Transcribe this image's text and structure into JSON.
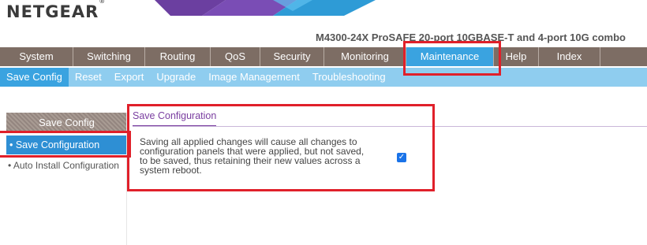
{
  "brand": {
    "logo": "NETGEAR",
    "trademark": "®"
  },
  "model": "M4300-24X ProSAFE 20-port 10GBASE-T and 4-port 10G combo",
  "nav": {
    "items": [
      "System",
      "Switching",
      "Routing",
      "QoS",
      "Security",
      "Monitoring",
      "Maintenance",
      "Help",
      "Index"
    ],
    "active": "Maintenance"
  },
  "subnav": {
    "items": [
      "Save Config",
      "Reset",
      "Export",
      "Upgrade",
      "Image Management",
      "Troubleshooting"
    ],
    "active": "Save Config"
  },
  "sidebar": {
    "header": "Save Config",
    "selected": "• Save Configuration",
    "item": "• Auto Install Configuration"
  },
  "main": {
    "section_title": "Save Configuration",
    "description": "Saving all applied changes will cause all changes to configuration panels that were applied, but not saved, to be saved, thus retaining their new values across a system reboot.",
    "checkbox_checked": true
  },
  "colors": {
    "nav_bg": "#7d6d64",
    "active_tab": "#3aa3e0",
    "subnav_bg": "#8fcdef",
    "accent_purple": "#7a3ea0",
    "highlight_red": "#e0202a"
  }
}
